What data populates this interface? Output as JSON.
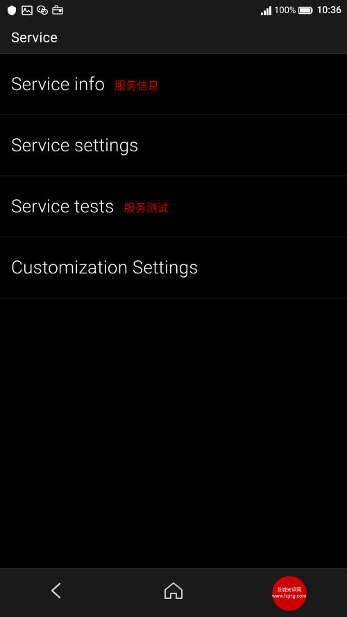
{
  "statusBar": {
    "time": "10:36",
    "battery": "100%",
    "icons": [
      "shield",
      "image",
      "wechat",
      "wallet"
    ]
  },
  "titleBar": {
    "title": "Service"
  },
  "menuItems": [
    {
      "id": "service-info",
      "label": "Service info",
      "badge": "服务信息"
    },
    {
      "id": "service-settings",
      "label": "Service settings",
      "badge": ""
    },
    {
      "id": "service-tests",
      "label": "Service tests",
      "badge": "服务测试"
    },
    {
      "id": "customization-settings",
      "label": "Customization Settings",
      "badge": ""
    }
  ],
  "bottomNav": {
    "back_label": "back",
    "home_label": "home",
    "watermark_line1": "龙城安卓网",
    "watermark_line2": "www.fcjrtg.com"
  }
}
